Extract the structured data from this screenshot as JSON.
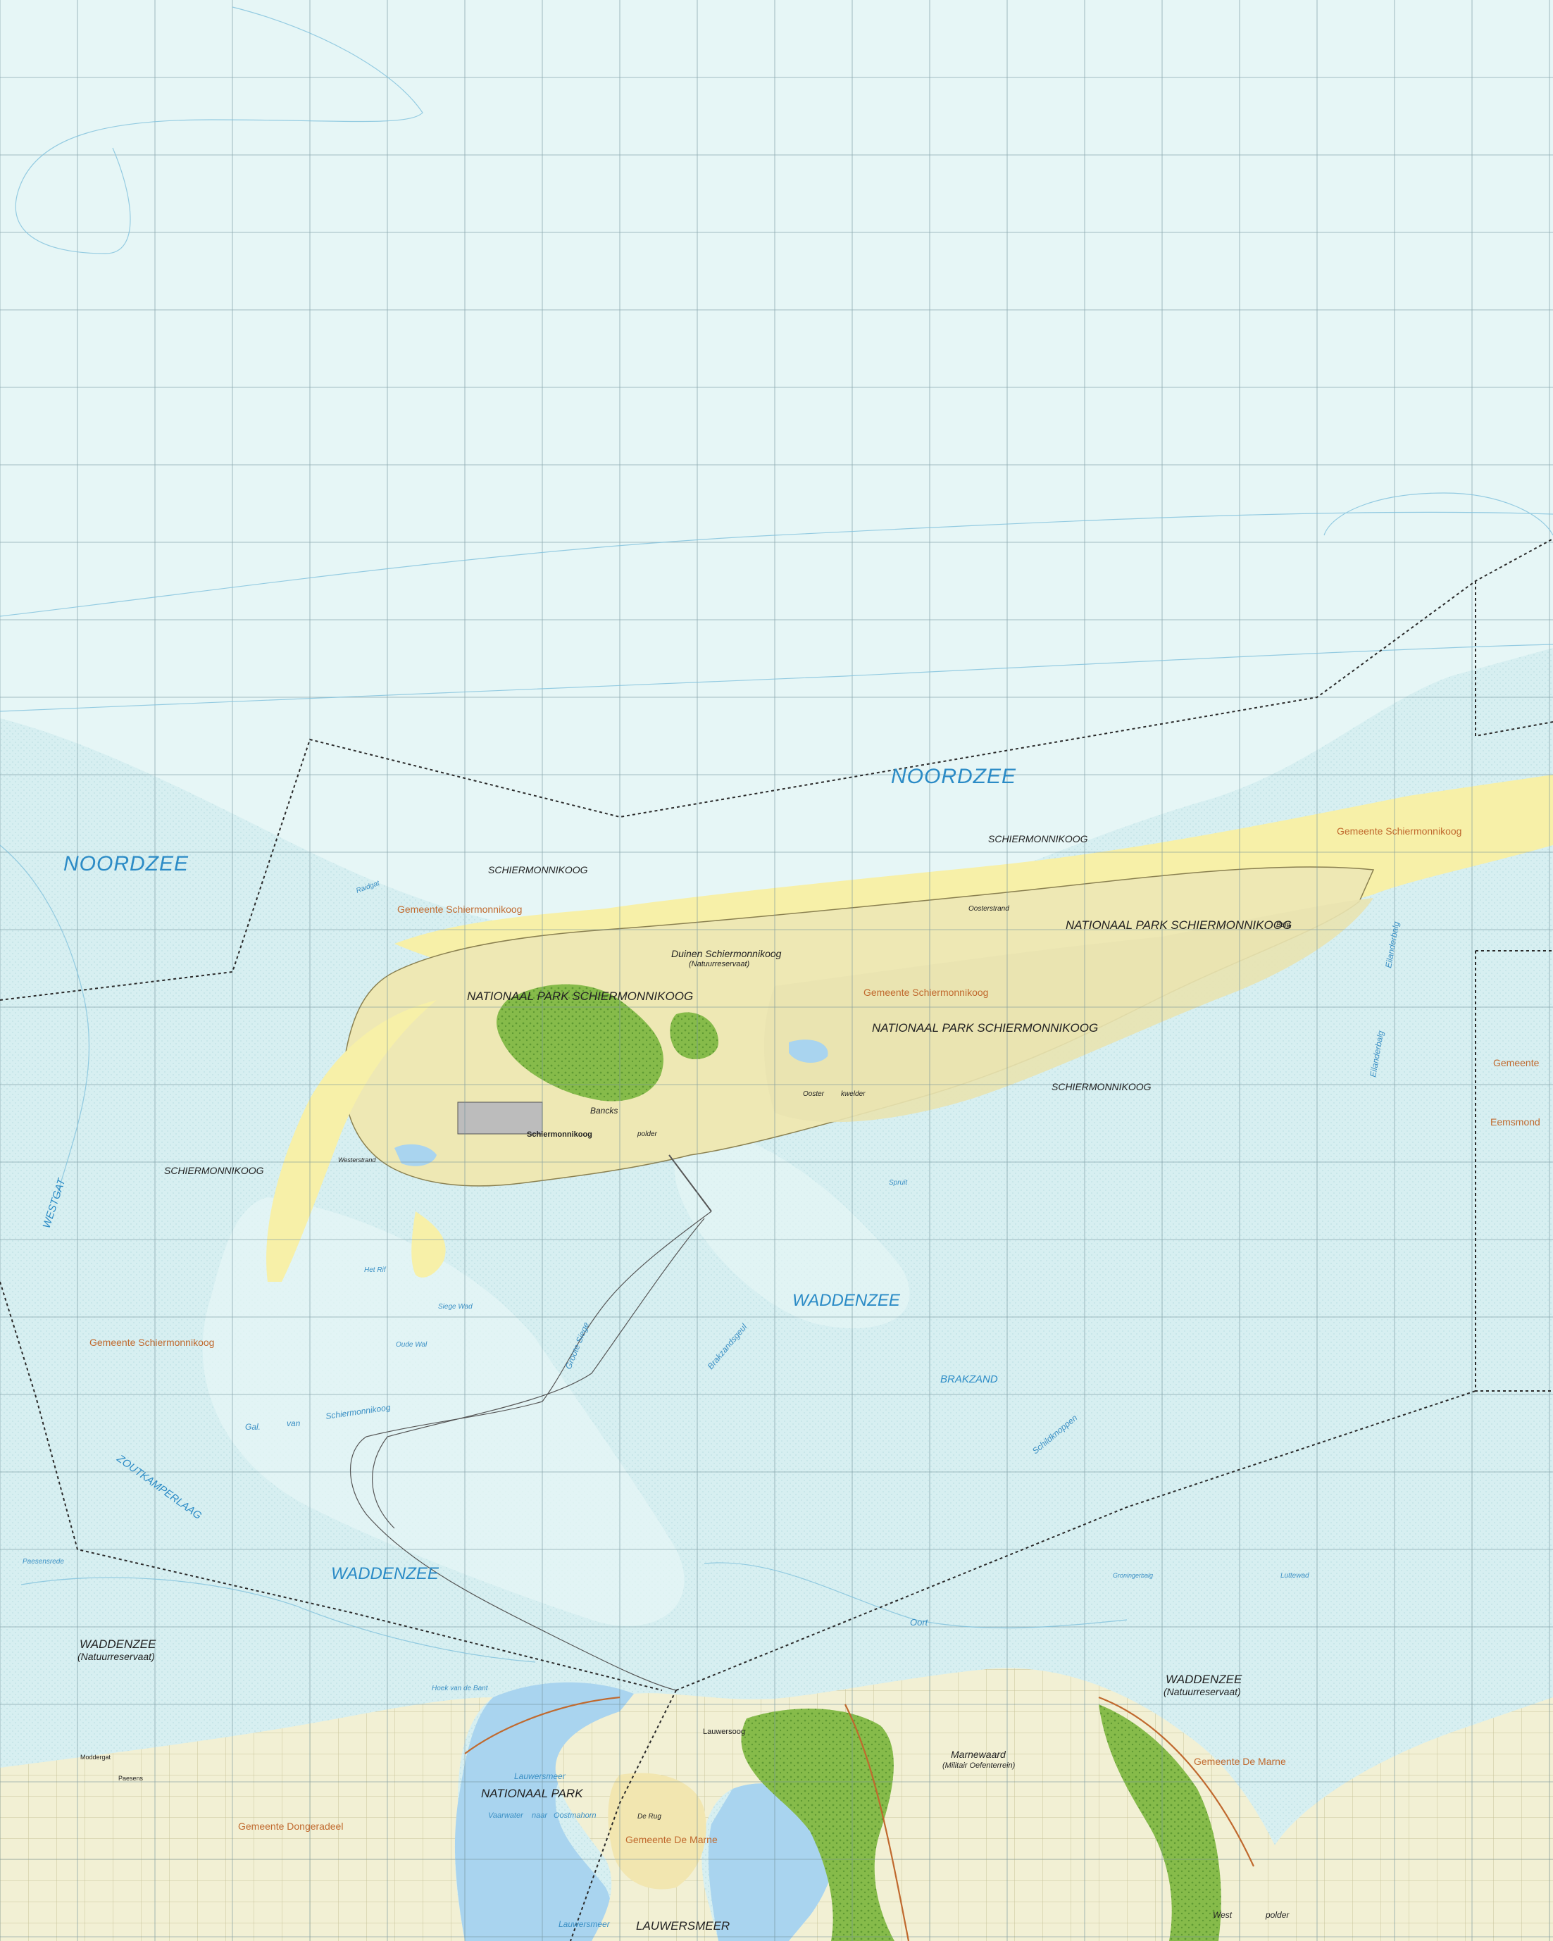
{
  "map": {
    "labels": {
      "noordzee_main": "NOORDZEE",
      "noordzee_west": "NOORDZEE",
      "waddenzee_center": "WADDENZEE",
      "waddenzee_west": "WADDENZEE",
      "waddenzee_res_west": "WADDENZEE",
      "natuurreservaat_west": "(Natuurreservaat)",
      "waddenzee_res_east": "WADDENZEE",
      "natuurreservaat_east": "(Natuurreservaat)",
      "schier_1": "SCHIERMONNIKOOG",
      "schier_2": "SCHIERMONNIKOOG",
      "schier_3": "SCHIERMONNIKOOG",
      "schier_4": "SCHIERMONNIKOOG",
      "np_1": "NATIONAAL PARK SCHIERMONNIKOOG",
      "np_2": "NATIONAAL PARK SCHIERMONNIKOOG",
      "np_3": "NATIONAAL PARK SCHIERMONNIKOOG",
      "duinen": "Duinen Schiermonnikoog",
      "duinen_res": "(Natuurreservaat)",
      "gem_schier_1": "Gemeente Schiermonnikoog",
      "gem_schier_2": "Gemeente Schiermonnikoog",
      "gem_schier_3": "Gemeente Schiermonnikoog",
      "gem_schier_4": "Gemeente Schiermonnikoog",
      "gem_demarne_1": "Gemeente De Marne",
      "gem_demarne_2": "Gemeente De Marne",
      "gem_dongeradeel": "Gemeente Dongeradeel",
      "gemeente_east": "Gemeente",
      "eemsmond": "Eemsmond",
      "westgat": "WESTGAT",
      "zoutkamperlaag": "ZOUTKAMPERLAAG",
      "brakzand": "BRAKZAND",
      "lauwersmeer": "LAUWERSMEER",
      "nationaal_park": "NATIONAAL PARK",
      "marneward": "Marnewaard",
      "marneward_sub": "(Militair Oefenterrein)",
      "schiermonnikoog_town": "Schiermonnikoog",
      "lauwersoog": "Lauwersoog",
      "gal": "Gal.",
      "van": "van",
      "schiermonnikoog_gat": "Schiermonnikoog",
      "eilanderbalg": "Eilanderbalg",
      "eilanderbalg2": "Eilanderbalg",
      "groote_siege": "Groote Siege",
      "brakzandsgeul": "Brakzandsgeul",
      "schildknoppen": "Schildknoppen",
      "oort": "Oort",
      "spruit": "Spruit",
      "het_rif": "Het Rif",
      "siege_wad": "Siege Wad",
      "oude_wal": "Oude Wal",
      "paesensrede": "Paesensrede",
      "hoek_van_de_bant": "Hoek van de Bant",
      "lauwersmeer_water": "Lauwersmeer",
      "vaarwater": "Vaarwater",
      "naar": "naar",
      "oostmahorn": "Oostmahorn",
      "lauwersmeer_water2": "Lauwersmeer",
      "de_rug": "De Rug",
      "oosterstrand": "Oosterstrand",
      "balg": "Balg",
      "west": "West",
      "polder": "polder",
      "oosterkwelder_a": "Ooster",
      "oosterkwelder_b": "kwelder",
      "banckspolder_a": "Bancks",
      "banckspolder_b": "polder",
      "westerstrand": "Westerstrand",
      "luttewad": "Luttewad",
      "groningerbalg": "Groningerbalg",
      "raidgat": "Raidgat",
      "moddergat": "Moddergat",
      "paesens": "Paesens"
    },
    "colors": {
      "sea": "#e6f6f6",
      "tidal_flat": "#d6eef0",
      "beach": "#f7f0a8",
      "dunes": "#eee8b4",
      "forest": "#8cbe4e",
      "lake": "#a9d4ef",
      "grid": "#6b8a94",
      "boundary": "#2a2a2a"
    }
  }
}
